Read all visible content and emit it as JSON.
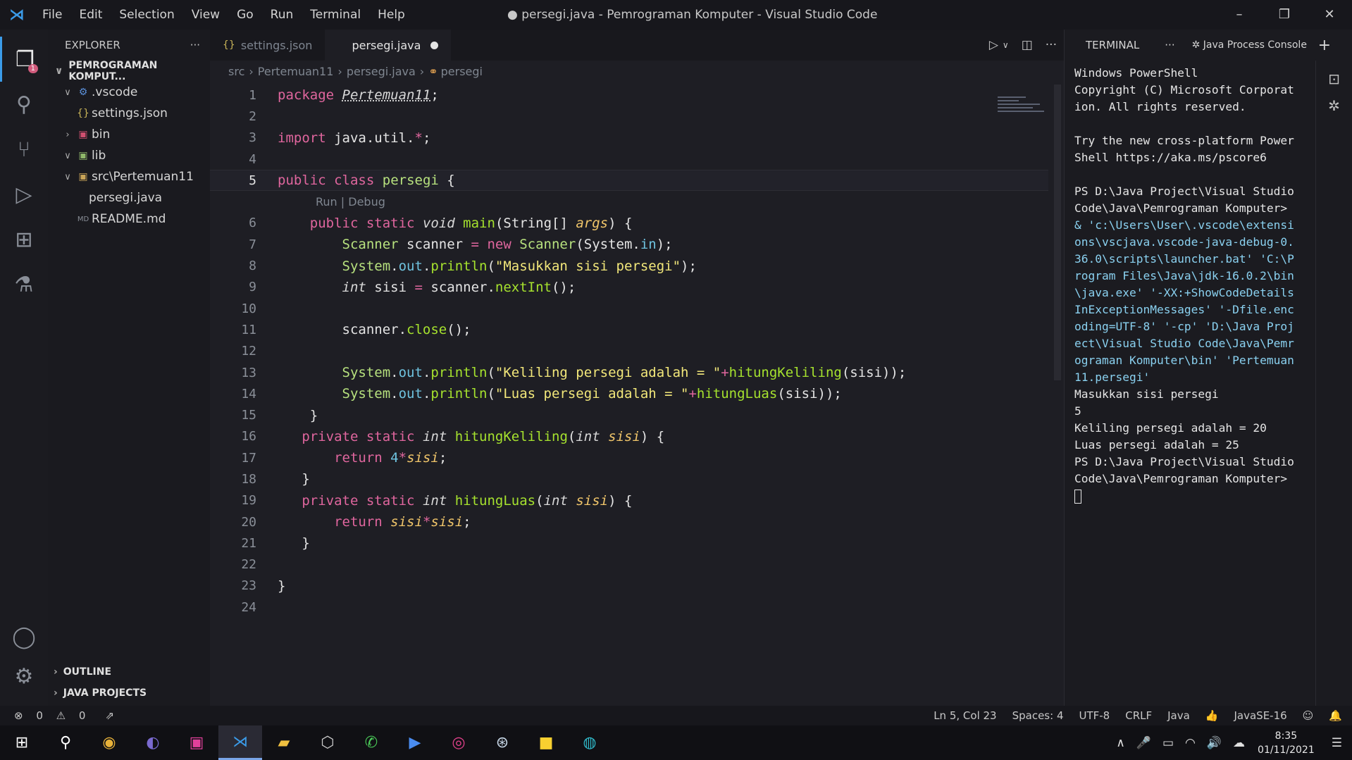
{
  "window": {
    "title": "● persegi.java - Pemrograman Komputer - Visual Studio Code",
    "menu": [
      "File",
      "Edit",
      "Selection",
      "View",
      "Go",
      "Run",
      "Terminal",
      "Help"
    ],
    "controls": [
      "–",
      "❐",
      "✕"
    ]
  },
  "activity": {
    "explorer_badge": "1"
  },
  "sidebar": {
    "header": "EXPLORER",
    "more": "···",
    "project": "PEMROGRAMAN KOMPUT...",
    "tree": [
      {
        "chev": "∨",
        "icon": "⚙",
        "label": ".vscode"
      },
      {
        "chev": "",
        "icon": "{}",
        "label": "settings.json"
      },
      {
        "chev": "›",
        "icon": "▣",
        "label": "bin"
      },
      {
        "chev": "∨",
        "icon": "▣",
        "label": "lib"
      },
      {
        "chev": "∨",
        "icon": "▣",
        "label": "src\\Pertemuan11"
      },
      {
        "chev": "",
        "icon": "",
        "label": "persegi.java"
      },
      {
        "chev": "",
        "icon": "MD",
        "label": "README.md"
      }
    ],
    "outline": "OUTLINE",
    "java_projects": "JAVA PROJECTS"
  },
  "editor": {
    "tabs": [
      {
        "label": "settings.json",
        "icon": "{}"
      },
      {
        "label": "persegi.java",
        "icon": ""
      }
    ],
    "breadcrumbs": [
      "src",
      "Pertemuan11",
      "persegi.java",
      "persegi"
    ],
    "codelens": "Run | Debug",
    "current_line": 5,
    "line_numbers": [
      "1",
      "2",
      "3",
      "4",
      "5",
      "6",
      "7",
      "8",
      "9",
      "10",
      "11",
      "12",
      "13",
      "14",
      "15",
      "16",
      "17",
      "18",
      "19",
      "20",
      "21",
      "22",
      "23",
      "24"
    ]
  },
  "terminal": {
    "title": "TERMINAL",
    "more": "···",
    "process": "Java Process Console",
    "plus": "+",
    "output": [
      "Windows PowerShell",
      "Copyright (C) Microsoft Corporation. All rights reserved.",
      "",
      "Try the new cross-platform PowerShell https://aka.ms/pscore6",
      "",
      "PS D:\\Java Project\\Visual Studio Code\\Java\\Pemrograman Komputer>"
    ],
    "command": " & 'c:\\Users\\User\\.vscode\\extensions\\vscjava.vscode-java-debug-0.36.0\\scripts\\launcher.bat' 'C:\\Program Files\\Java\\jdk-16.0.2\\bin\\java.exe' '-XX:+ShowCodeDetailsInExceptionMessages' '-Dfile.encoding=UTF-8' '-cp' 'D:\\Java Project\\Visual Studio Code\\Java\\Pemrograman Komputer\\bin' 'Pertemuan11.persegi'",
    "result": [
      "Masukkan sisi persegi",
      "5",
      "Keliling persegi adalah = 20",
      "Luas persegi adalah = 25",
      "PS D:\\Java Project\\Visual Studio Code\\Java\\Pemrograman Komputer> "
    ]
  },
  "status": {
    "errors": "0",
    "warnings": "0",
    "position": "Ln 5, Col 23",
    "spaces": "Spaces: 4",
    "encoding": "UTF-8",
    "eol": "CRLF",
    "language": "Java",
    "runtime": "JavaSE-16"
  },
  "taskbar": {
    "time": "8:35",
    "date": "01/11/2021"
  }
}
